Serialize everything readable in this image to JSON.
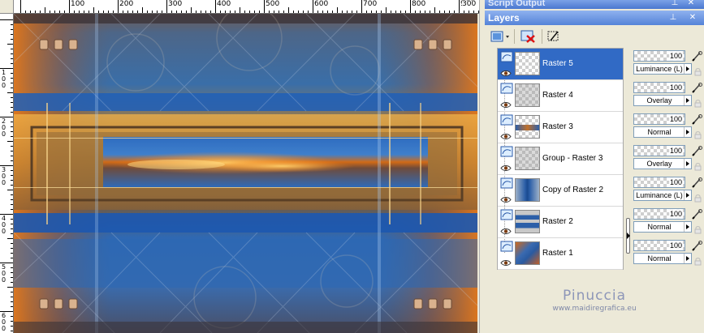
{
  "palettes": {
    "script_output_title": "Script Output",
    "layers_title": "Layers"
  },
  "ruler": {
    "h_labels": [
      "100",
      "200",
      "300",
      "400",
      "500",
      "600",
      "700",
      "800",
      "900"
    ],
    "v_labels": [
      "1\n0\n0",
      "2\n0\n0",
      "3\n0\n0",
      "4\n0\n0",
      "5\n0\n0",
      "6\n0\n0"
    ],
    "h_right_label": "300"
  },
  "layers": [
    {
      "name": "Raster 5",
      "opacity": "100",
      "blend": "Luminance (L)",
      "selected": true,
      "thumb": "checker"
    },
    {
      "name": "Raster 4",
      "opacity": "100",
      "blend": "Overlay",
      "selected": false,
      "thumb": "gray"
    },
    {
      "name": "Raster 3",
      "opacity": "100",
      "blend": "Normal",
      "selected": false,
      "thumb": "band"
    },
    {
      "name": "Group - Raster 3",
      "opacity": "100",
      "blend": "Overlay",
      "selected": false,
      "thumb": "gray"
    },
    {
      "name": "Copy of Raster 2",
      "opacity": "100",
      "blend": "Luminance (L)",
      "selected": false,
      "thumb": "blue-center"
    },
    {
      "name": "Raster 2",
      "opacity": "100",
      "blend": "Normal",
      "selected": false,
      "thumb": "blue-bars"
    },
    {
      "name": "Raster 1",
      "opacity": "100",
      "blend": "Normal",
      "selected": false,
      "thumb": "image"
    }
  ],
  "watermark": {
    "name": "Pinuccia",
    "url": "www.maidiregrafica.eu"
  },
  "colors": {
    "selection": "#316ac5",
    "titlebar": "#5583d8",
    "panel_bg": "#ece9d8"
  }
}
